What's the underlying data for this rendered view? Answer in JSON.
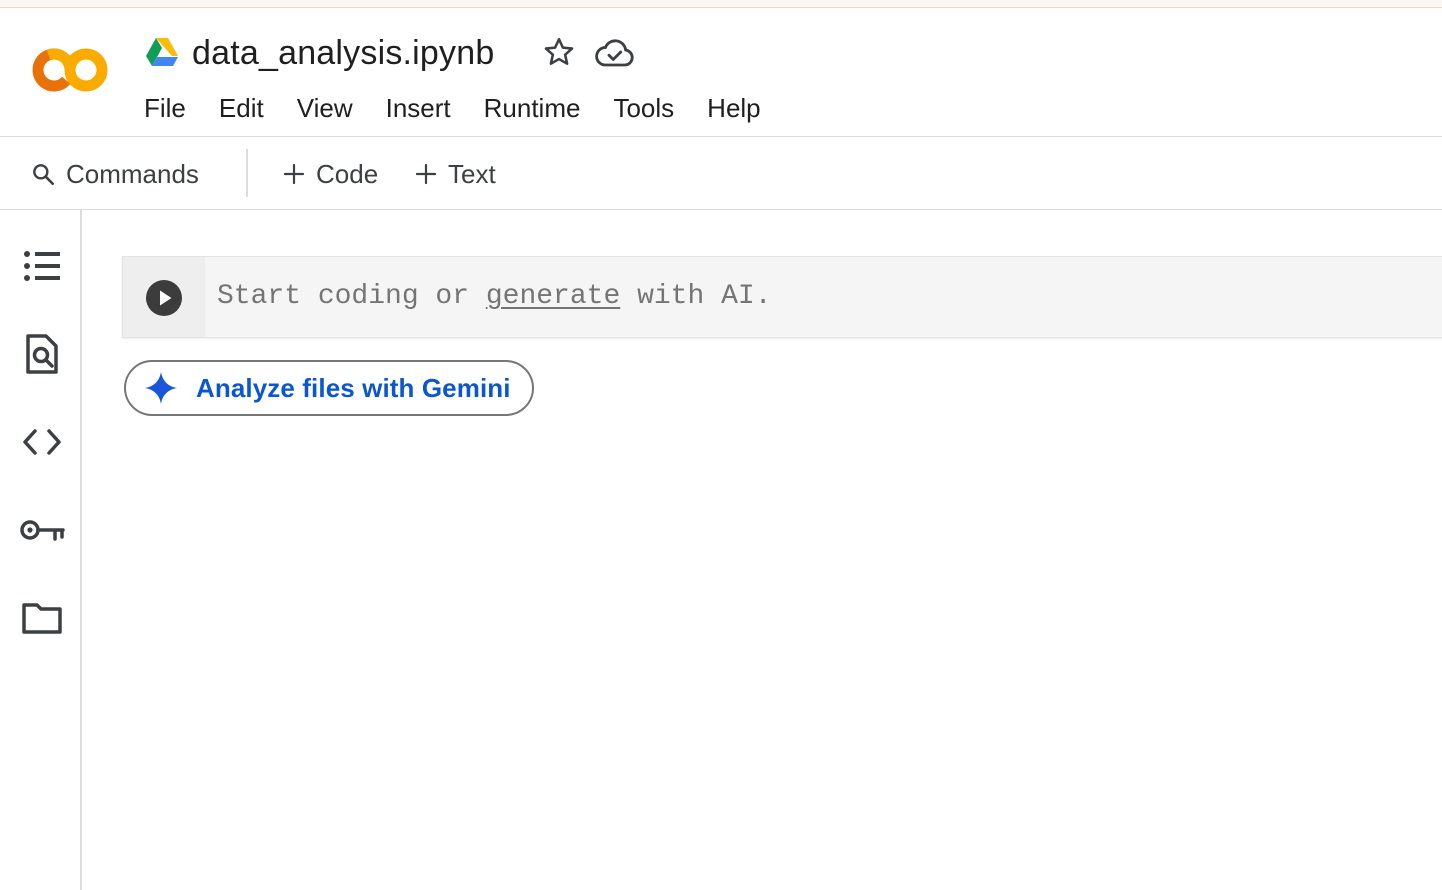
{
  "document": {
    "title": "data_analysis.ipynb"
  },
  "menu": {
    "items": [
      {
        "label": "File"
      },
      {
        "label": "Edit"
      },
      {
        "label": "View"
      },
      {
        "label": "Insert"
      },
      {
        "label": "Runtime"
      },
      {
        "label": "Tools"
      },
      {
        "label": "Help"
      }
    ]
  },
  "toolbar": {
    "commands_label": "Commands",
    "add_code_label": "Code",
    "add_text_label": "Text"
  },
  "sidebar": {
    "icons": [
      "table-of-contents-icon",
      "find-replace-icon",
      "code-snippets-icon",
      "secrets-key-icon",
      "files-folder-icon"
    ]
  },
  "cell": {
    "placeholder_prefix": "Start coding or ",
    "placeholder_link": "generate",
    "placeholder_suffix": " with AI."
  },
  "gemini": {
    "button_label": "Analyze files with Gemini"
  },
  "colors": {
    "logo_orange": "#f9ab00",
    "logo_dark_orange": "#e8710a",
    "gemini_blue": "#0b57d0",
    "text_dark": "#1f1f1f",
    "placeholder_gray": "#757575"
  }
}
